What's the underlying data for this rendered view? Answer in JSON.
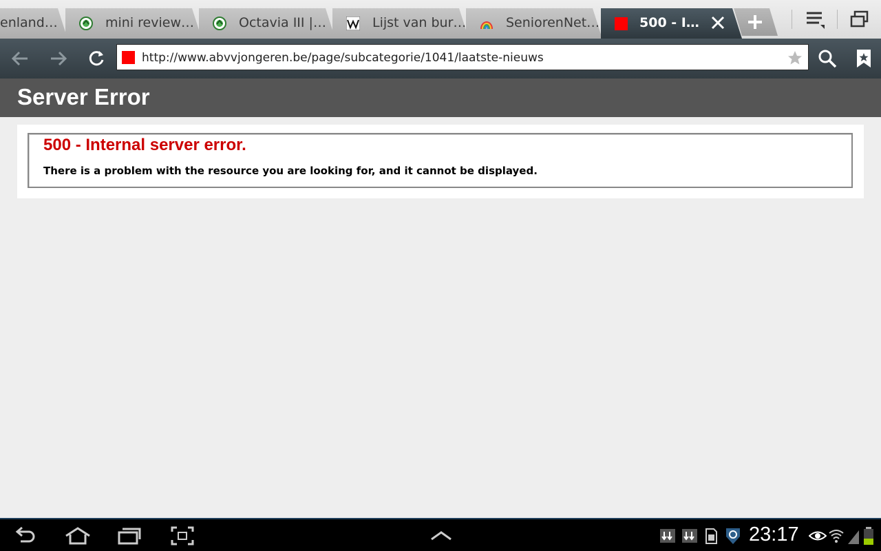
{
  "tabs": [
    {
      "title": "enland…",
      "favicon": "generic-favicon"
    },
    {
      "title": "mini review…",
      "favicon": "skoda-favicon"
    },
    {
      "title": "Octavia III |…",
      "favicon": "skoda-favicon"
    },
    {
      "title": "Lijst van bur…",
      "favicon": "wikipedia-favicon"
    },
    {
      "title": "SeniorenNet…",
      "favicon": "seniorennet-favicon"
    },
    {
      "title": "500 - I…",
      "favicon": "red-square-favicon",
      "active": true
    }
  ],
  "address_bar": {
    "url": "http://www.abvvjongeren.be/page/subcategorie/1041/laatste-nieuws"
  },
  "page": {
    "header_title": "Server Error",
    "error_heading": "500 - Internal server error.",
    "error_detail": "There is a problem with the resource you are looking for, and it cannot be displayed."
  },
  "system_bar": {
    "clock": "23:17"
  },
  "colors": {
    "error_red": "#cc0000",
    "header_gray": "#555555",
    "toolbar": "#3c474e",
    "favicon_red": "#ff0000"
  }
}
